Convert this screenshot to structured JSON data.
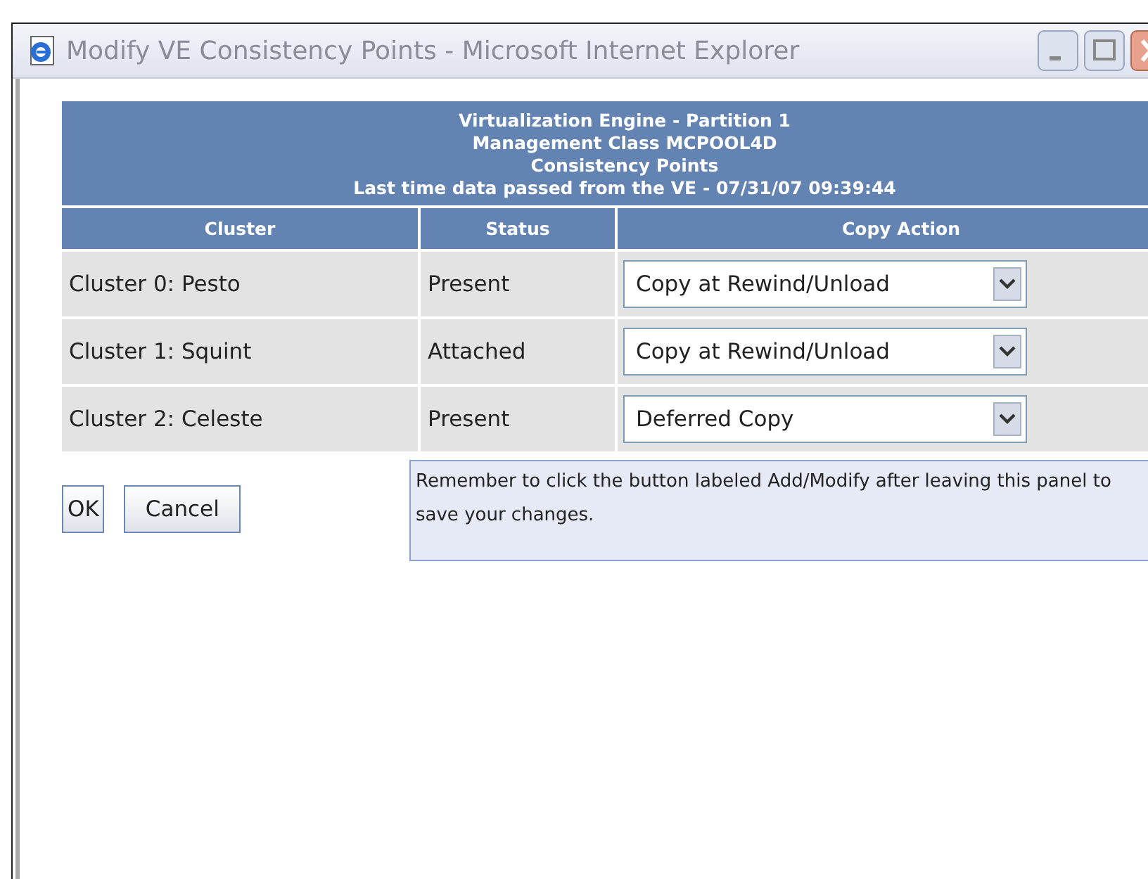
{
  "window": {
    "title": "Modify VE Consistency Points - Microsoft Internet Explorer"
  },
  "header": {
    "lines": [
      "Virtualization Engine - Partition 1",
      "Management Class MCPOOL4D",
      "Consistency Points",
      "Last time data passed from the VE - 07/31/07 09:39:44"
    ]
  },
  "table": {
    "columns": [
      "Cluster",
      "Status",
      "Copy Action"
    ],
    "rows": [
      {
        "cluster": "Cluster 0: Pesto",
        "status": "Present",
        "copy_action": "Copy at Rewind/Unload"
      },
      {
        "cluster": "Cluster 1: Squint",
        "status": "Attached",
        "copy_action": "Copy at Rewind/Unload"
      },
      {
        "cluster": "Cluster 2: Celeste",
        "status": "Present",
        "copy_action": "Deferred Copy"
      }
    ]
  },
  "buttons": [
    "OK",
    "Cancel"
  ],
  "note": "Remember to click the button labeled Add/Modify after leaving this panel to save your changes."
}
